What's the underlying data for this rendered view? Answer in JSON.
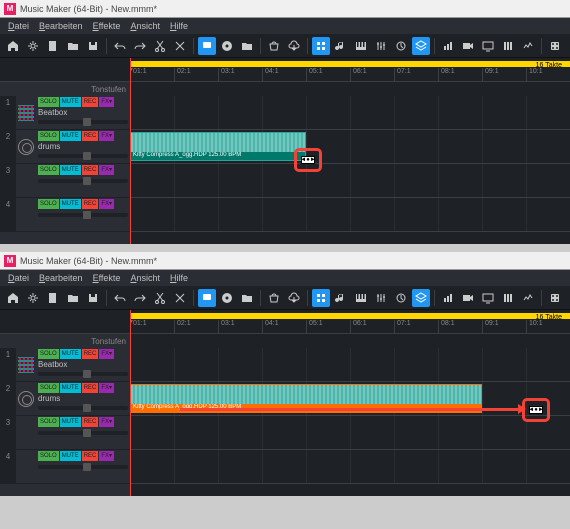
{
  "title": "Music Maker (64-Bit) - New.mmm*",
  "menu": [
    "Datei",
    "Bearbeiten",
    "Effekte",
    "Ansicht",
    "Hilfe"
  ],
  "yellow_label": "16 Takte",
  "ruler": [
    "01:1",
    "02:1",
    "03:1",
    "04:1",
    "05:1",
    "06:1",
    "07:1",
    "08:1",
    "09:1",
    "10:1"
  ],
  "tonstufen": "Tonstufen",
  "tracks": [
    {
      "num": "1",
      "name": "Beatbox",
      "solo": "SOLO",
      "mute": "MUTE",
      "rec": "REC",
      "fx": "FX▾"
    },
    {
      "num": "2",
      "name": "drums",
      "solo": "SOLO",
      "mute": "MUTE",
      "rec": "REC",
      "fx": "FX▾"
    },
    {
      "num": "3",
      "name": "",
      "solo": "SOLO",
      "mute": "MUTE",
      "rec": "REC",
      "fx": "FX▾"
    },
    {
      "num": "4",
      "name": "",
      "solo": "SOLO",
      "mute": "MUTE",
      "rec": "REC",
      "fx": "FX▾"
    }
  ],
  "clip_label": "Kitty Compress A_ogg.HDP  125.00 BPM",
  "handle_glyph": "◄●►"
}
